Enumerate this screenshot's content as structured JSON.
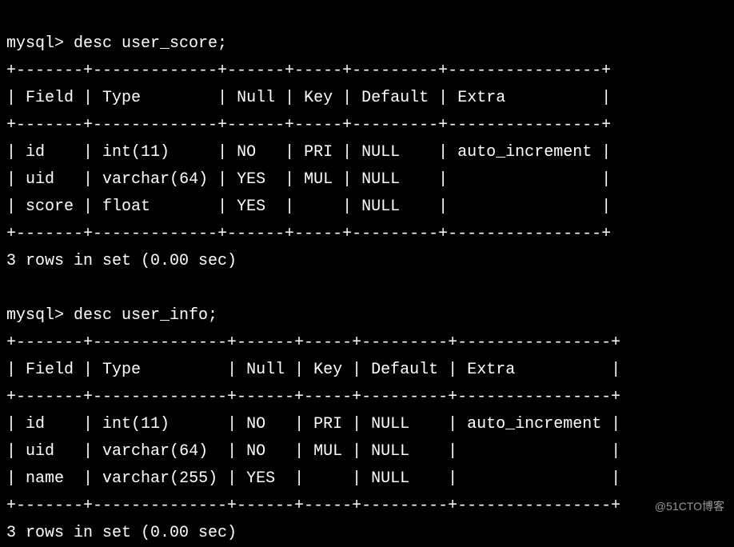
{
  "terminal": {
    "prompt": "mysql>",
    "queries": [
      {
        "command": "desc user_score;",
        "result_footer": "3 rows in set (0.00 sec)",
        "table": {
          "headers": [
            "Field",
            "Type",
            "Null",
            "Key",
            "Default",
            "Extra"
          ],
          "rows": [
            {
              "Field": "id",
              "Type": "int(11)",
              "Null": "NO",
              "Key": "PRI",
              "Default": "NULL",
              "Extra": "auto_increment"
            },
            {
              "Field": "uid",
              "Type": "varchar(64)",
              "Null": "YES",
              "Key": "MUL",
              "Default": "NULL",
              "Extra": ""
            },
            {
              "Field": "score",
              "Type": "float",
              "Null": "YES",
              "Key": "",
              "Default": "NULL",
              "Extra": ""
            }
          ]
        }
      },
      {
        "command": "desc user_info;",
        "result_footer": "3 rows in set (0.00 sec)",
        "table": {
          "headers": [
            "Field",
            "Type",
            "Null",
            "Key",
            "Default",
            "Extra"
          ],
          "rows": [
            {
              "Field": "id",
              "Type": "int(11)",
              "Null": "NO",
              "Key": "PRI",
              "Default": "NULL",
              "Extra": "auto_increment"
            },
            {
              "Field": "uid",
              "Type": "varchar(64)",
              "Null": "NO",
              "Key": "MUL",
              "Default": "NULL",
              "Extra": ""
            },
            {
              "Field": "name",
              "Type": "varchar(255)",
              "Null": "YES",
              "Key": "",
              "Default": "NULL",
              "Extra": ""
            }
          ]
        }
      }
    ]
  },
  "watermark": "@51CTO博客"
}
